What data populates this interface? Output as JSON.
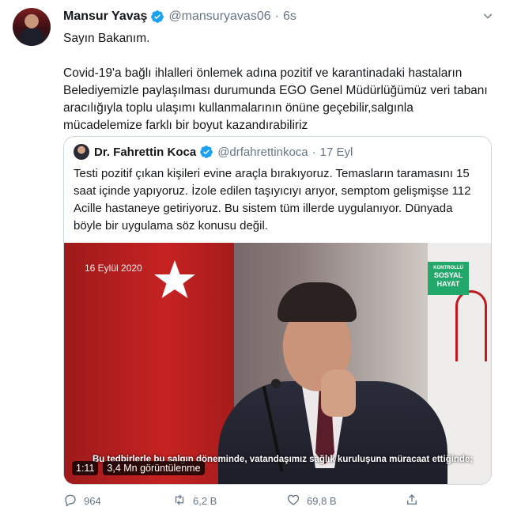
{
  "tweet": {
    "author_name": "Mansur Yavaş",
    "author_handle": "@mansuryavas06",
    "separator": "·",
    "time": "6s",
    "text": "Sayın Bakanım.\n\nCovid-19'a bağlı  ihlalleri önlemek adına pozitif ve karantinadaki hastaların Belediyemizle paylaşılması durumunda EGO Genel Müdürlüğümüz veri tabanı aracılığıyla toplu ulaşımı kullanmalarının önüne geçebilir,salgınla mücadelemize farklı bir boyut kazandırabiliriz"
  },
  "quoted": {
    "author_name": "Dr. Fahrettin Koca",
    "author_handle": "@drfahrettinkoca",
    "separator": "·",
    "time": "17 Eyl",
    "text": "Testi pozitif çıkan kişileri evine araçla bırakıyoruz. Temasların taramasını 15 saat içinde yapıyoruz. İzole edilen taşıyıcıyı arıyor, semptom gelişmişse 112 Acille hastaneye getiriyoruz. Bu sistem tüm illerde uygulanıyor. Dünyada böyle bir uygulama söz konusu değil.",
    "video": {
      "date_overlay": "16 Eylül 2020",
      "badge_line1": "KONTROLLÜ",
      "badge_line2": "SOSYAL",
      "badge_line3": "HAYAT",
      "subtitle": "Bu tedbirlerle bu salgın döneminde, vatandaşımız sağlık kuruluşuna müracaat ettiğinde;",
      "duration": "1:11",
      "views": "3,4 Mn görüntülenme"
    }
  },
  "actions": {
    "replies": "964",
    "retweets": "6,2 B",
    "likes": "69,8 B"
  },
  "icons": {
    "verified": "verified-badge-icon",
    "caret": "chevron-down-icon",
    "reply": "reply-icon",
    "retweet": "retweet-icon",
    "like": "heart-icon",
    "share": "share-icon"
  },
  "colors": {
    "verified": "#1da1f2",
    "muted": "#657786",
    "border": "#ccd6dd"
  }
}
